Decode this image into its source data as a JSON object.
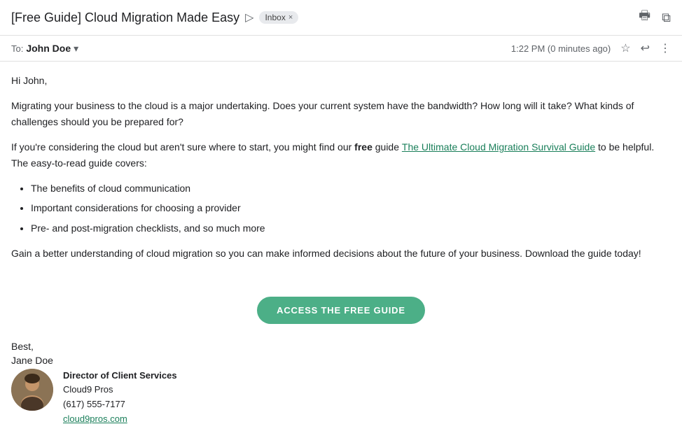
{
  "header": {
    "subject": "[Free Guide] Cloud Migration Made Easy",
    "forward_icon": "▷",
    "inbox_label": "Inbox",
    "inbox_x": "×",
    "print_icon": "🖶",
    "external_icon": "⧉"
  },
  "meta": {
    "to_label": "To:",
    "recipient_name": "John Doe",
    "timestamp": "1:22 PM (0 minutes ago)",
    "star_icon": "☆",
    "reply_icon": "↩",
    "more_icon": "⋮"
  },
  "body": {
    "greeting": "Hi John,",
    "paragraph1": "Migrating your business to the cloud is a major undertaking. Does your current system have the bandwidth? How long will it take? What kinds of challenges should you be prepared for?",
    "paragraph2_before_bold": "If you're considering the cloud but aren't sure where to start, you might find our ",
    "paragraph2_bold": "free",
    "paragraph2_after_bold": " guide ",
    "paragraph2_link": "The Ultimate Cloud Migration Survival Guide",
    "paragraph2_after_link": " to be helpful. The easy-to-read guide covers:",
    "bullet1": "The benefits of cloud communication",
    "bullet2": "Important considerations for choosing a provider",
    "bullet3": "Pre- and post-migration checklists, and so much more",
    "paragraph3": "Gain a better understanding of cloud migration so you can make informed decisions about the future of your business. Download the guide today!",
    "cta_button": "ACCESS THE FREE GUIDE",
    "closing": "Best,",
    "sender_name": "Jane Doe"
  },
  "signature": {
    "title": "Director of Client Services",
    "company": "Cloud9 Pros",
    "phone": "(617) 555-7177",
    "website": "cloud9pros.com"
  },
  "colors": {
    "cta_bg": "#4caf87",
    "link": "#1a7f5a"
  }
}
